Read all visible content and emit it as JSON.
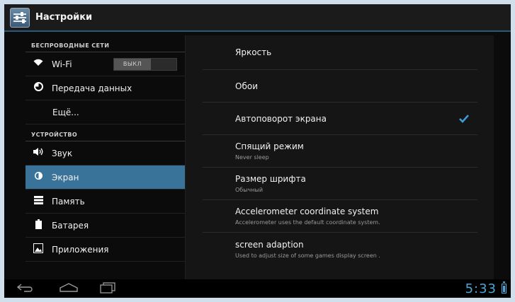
{
  "app": {
    "title": "Настройки",
    "icon": "settings-sliders-icon"
  },
  "left": {
    "sections": [
      {
        "header": "БЕСПРОВОДНЫЕ СЕТИ",
        "items": [
          {
            "label": "Wi-Fi",
            "icon": "wifi-icon",
            "toggle": "ВЫКЛ"
          },
          {
            "label": "Передача данных",
            "icon": "data-usage-icon"
          },
          {
            "label": "Ещё..."
          }
        ]
      },
      {
        "header": "УСТРОЙСТВО",
        "items": [
          {
            "label": "Звук",
            "icon": "volume-icon"
          },
          {
            "label": "Экран",
            "icon": "brightness-icon",
            "selected": true
          },
          {
            "label": "Память",
            "icon": "storage-icon"
          },
          {
            "label": "Батарея",
            "icon": "battery-icon"
          },
          {
            "label": "Приложения",
            "icon": "apps-icon"
          }
        ]
      }
    ]
  },
  "right": {
    "prefs": [
      {
        "title": "Яркость"
      },
      {
        "title": "Обои"
      },
      {
        "title": "Автоповорот экрана",
        "checked": true
      },
      {
        "title": "Спящий режим",
        "subtitle": "Never sleep"
      },
      {
        "title": "Размер шрифта",
        "subtitle": "Обычный"
      },
      {
        "title": "Accelerometer coordinate system",
        "subtitle": "Accelerometer uses the default coordinate system."
      },
      {
        "title": "screen adaption",
        "subtitle": "Used to adjust size of some games display screen ."
      }
    ]
  },
  "navbar": {
    "clock": "5:33"
  },
  "colors": {
    "accent": "#39739a",
    "clock": "#4aa9d8",
    "background": "#0b0b0b"
  }
}
